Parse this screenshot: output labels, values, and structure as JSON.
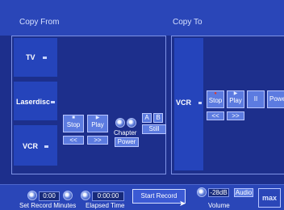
{
  "header": {
    "copy_from": "Copy From",
    "copy_to": "Copy To"
  },
  "sources": [
    {
      "label": "TV"
    },
    {
      "label": "Laserdisc"
    },
    {
      "label": "VCR"
    }
  ],
  "left_controls": {
    "stop": "Stop",
    "play": "Play",
    "rew": "<<",
    "ffw": ">>",
    "chapter": "Chapter",
    "a": "A",
    "b": "B",
    "still": "Still",
    "power": "Power",
    "stop_icon": "stop-icon",
    "play_icon": "play-icon"
  },
  "dest": {
    "label": "VCR",
    "stop": "Stop",
    "play": "Play",
    "pause": "II",
    "power": "Powe",
    "rew": "<<",
    "ffw": ">>"
  },
  "footer": {
    "rec_minutes": "0:00",
    "elapsed": "0:00:00",
    "start_record": "Start Record",
    "audio_level": "-28dB",
    "audio": "Audio",
    "label_set_record": "Set Record Minutes",
    "label_elapsed": "Elapsed Time",
    "label_volume": "Volume"
  },
  "colors": {
    "background": "#1d2f8c",
    "header": "#2a46b8",
    "button": "#5c7be0",
    "record_dot": "#e23b2b"
  }
}
